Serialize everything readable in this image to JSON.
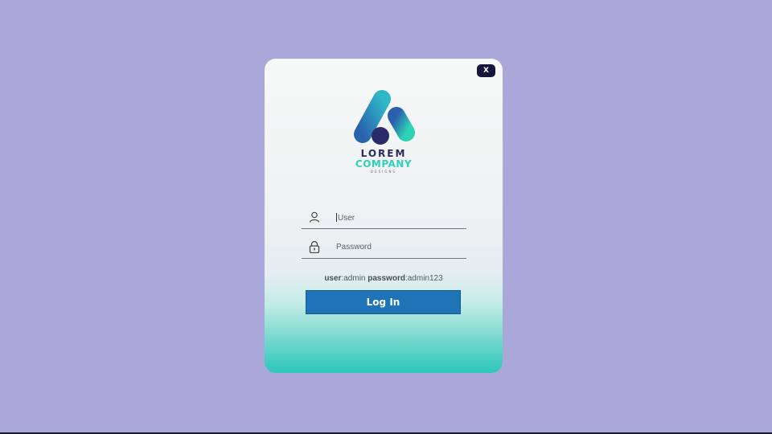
{
  "window": {
    "close_label": "X"
  },
  "logo": {
    "line1": "LOREM",
    "line2": "COMPANY",
    "line3": "DESIGNS"
  },
  "form": {
    "user_value": "User",
    "password_placeholder": "Password",
    "hint_user_key": "user",
    "hint_user_value": "admin",
    "hint_pass_key": "password",
    "hint_pass_value": "admin123",
    "login_label": "Log In"
  },
  "icons": {
    "user": "user-icon",
    "password": "lock-icon",
    "close": "close-icon"
  },
  "colors": {
    "background": "#a9a8d8",
    "button": "#1f74b8",
    "logo_blue": "#2f7cbf",
    "logo_teal": "#2fd2b6",
    "logo_navy": "#2a2c55"
  }
}
